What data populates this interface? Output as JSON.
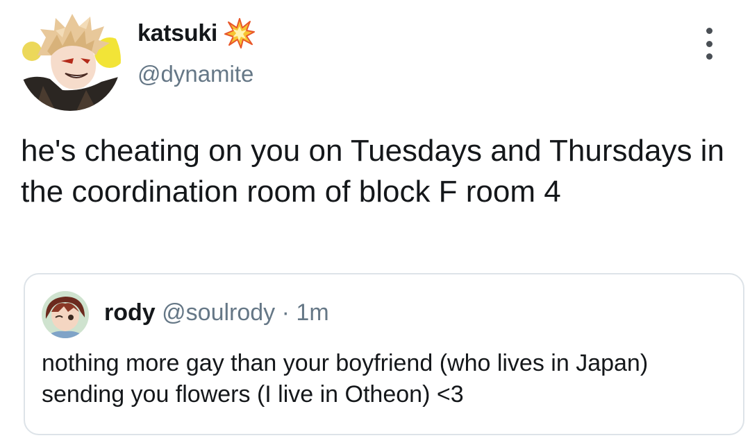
{
  "tweet": {
    "display_name": "katsuki",
    "name_emoji": "collision-emoji-icon",
    "handle": "@dynamite",
    "text": "he's cheating on you on Tuesdays and Thursdays in the coordination room of block F room 4",
    "more_icon": "more-vertical-icon"
  },
  "quoted_tweet": {
    "display_name": "rody",
    "handle": "@soulrody",
    "separator": "·",
    "time": "1m",
    "text": "nothing more gay than your boyfriend (who lives in Japan) sending you flowers (I live in Otheon) <3"
  },
  "colors": {
    "text_primary": "#14171a",
    "text_secondary": "#657786",
    "card_border": "#dde3e8"
  }
}
